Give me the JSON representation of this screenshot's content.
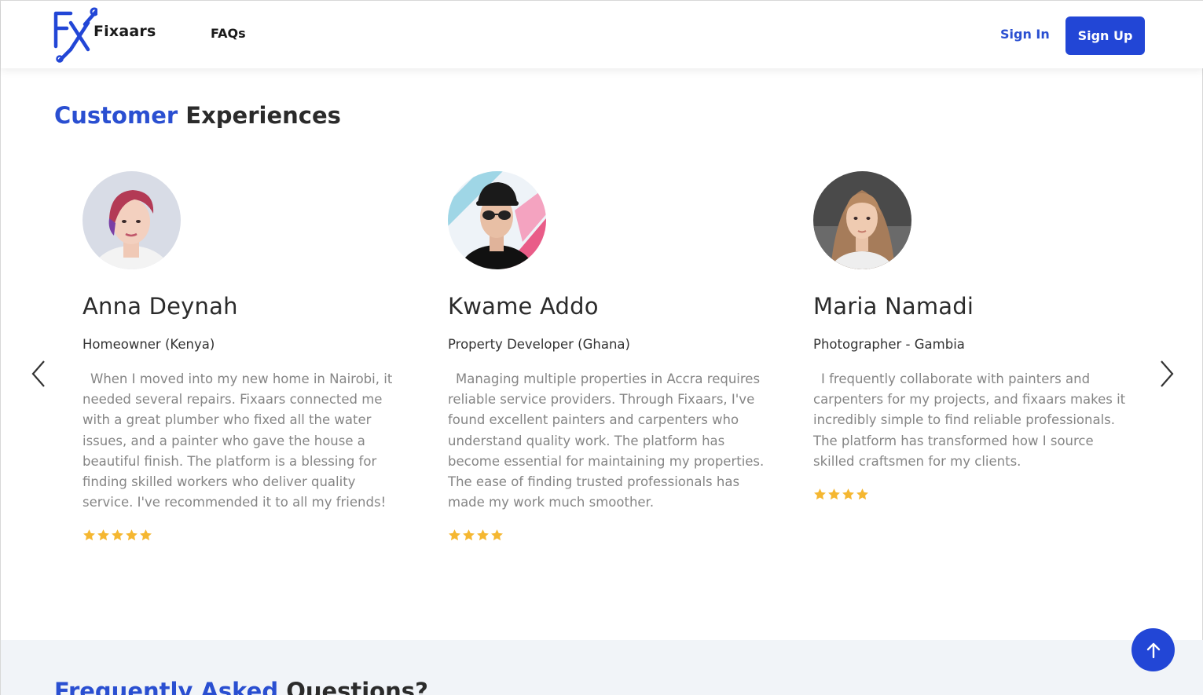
{
  "nav": {
    "logo_text": "Fixaars",
    "faq_label": "FAQs",
    "signin_label": "Sign In",
    "signup_label": "Sign Up"
  },
  "section": {
    "title_accent": "Customer",
    "title_rest": "Experiences"
  },
  "testimonials": [
    {
      "name": "Anna Deynah",
      "role": "Homeowner (Kenya)",
      "quote": "When I moved into my new home in Nairobi, it needed several repairs. Fixaars connected me with a great plumber who fixed all the water issues, and a painter who gave the house a beautiful finish. The platform is a blessing for finding skilled workers who deliver quality service. I've recommended it to all my friends!",
      "rating": 5
    },
    {
      "name": "Kwame Addo",
      "role": "Property Developer (Ghana)",
      "quote": "Managing multiple properties in Accra requires reliable service providers. Through Fixaars, I've found excellent painters and carpenters who understand quality work. The platform has become essential for maintaining my properties. The ease of finding trusted professionals has made my work much smoother.",
      "rating": 4
    },
    {
      "name": "Maria Namadi",
      "role": "Photographer - Gambia",
      "quote": "I frequently collaborate with painters and carpenters for my projects, and fixaars makes it incredibly simple to find reliable professionals. The platform has transformed how I source skilled craftsmen for my clients.",
      "rating": 4
    }
  ],
  "faq": {
    "title_accent": "Frequently Asked",
    "title_rest": "Questions?"
  },
  "colors": {
    "brand_blue": "#2246d6",
    "star": "#f5b731"
  },
  "icons": {
    "prev": "chevron-left-icon",
    "next": "chevron-right-icon",
    "to_top": "arrow-up-icon"
  }
}
